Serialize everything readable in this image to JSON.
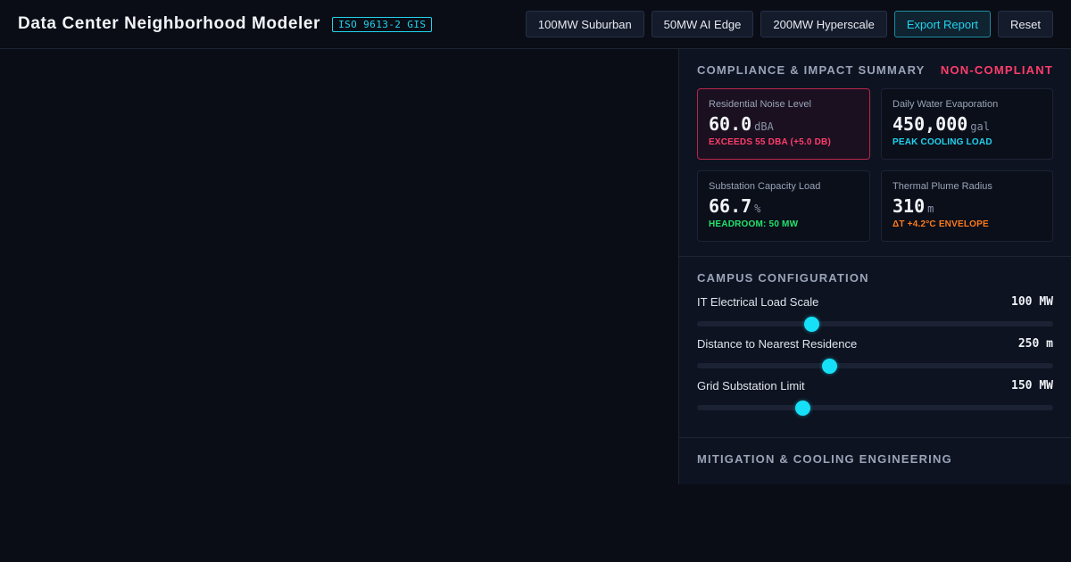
{
  "app": {
    "title": "Data Center Neighborhood Modeler",
    "standard_badge": "ISO 9613-2 GIS"
  },
  "toolbar": {
    "presets": [
      "100MW Suburban",
      "50MW AI Edge",
      "200MW Hyperscale"
    ],
    "export_label": "Export Report",
    "reset_label": "Reset"
  },
  "summary": {
    "title": "COMPLIANCE & IMPACT SUMMARY",
    "status": "NON-COMPLIANT",
    "cards": [
      {
        "label": "Residential Noise Level",
        "value": "60.0",
        "unit": "dBA",
        "note": "EXCEEDS 55 DBA (+5.0 DB)",
        "note_color": "#ff3d6b",
        "alert": true
      },
      {
        "label": "Daily Water Evaporation",
        "value": "450,000",
        "unit": "gal",
        "note": "PEAK COOLING LOAD",
        "note_color": "#22d3ee",
        "alert": false
      },
      {
        "label": "Substation Capacity Load",
        "value": "66.7",
        "unit": "%",
        "note": "HEADROOM: 50 MW",
        "note_color": "#22e36b",
        "alert": false
      },
      {
        "label": "Thermal Plume Radius",
        "value": "310",
        "unit": "m",
        "note": "ΔT +4.2°C ENVELOPE",
        "note_color": "#ff7a1a",
        "alert": false
      }
    ]
  },
  "campus": {
    "title": "CAMPUS CONFIGURATION",
    "sliders": [
      {
        "label": "IT Electrical Load Scale",
        "value": "100 MW",
        "level": 0.32
      },
      {
        "label": "Distance to Nearest Residence",
        "value": "250 m",
        "level": 0.37
      },
      {
        "label": "Grid Substation Limit",
        "value": "150 MW",
        "level": 0.295
      }
    ]
  },
  "mitigation": {
    "title": "MITIGATION & COOLING ENGINEERING"
  },
  "colors": {
    "accent": "#22d3ee",
    "alert": "#ff3d6b",
    "ok": "#22e36b",
    "warn": "#ff7a1a",
    "background": "#0a0d15"
  }
}
